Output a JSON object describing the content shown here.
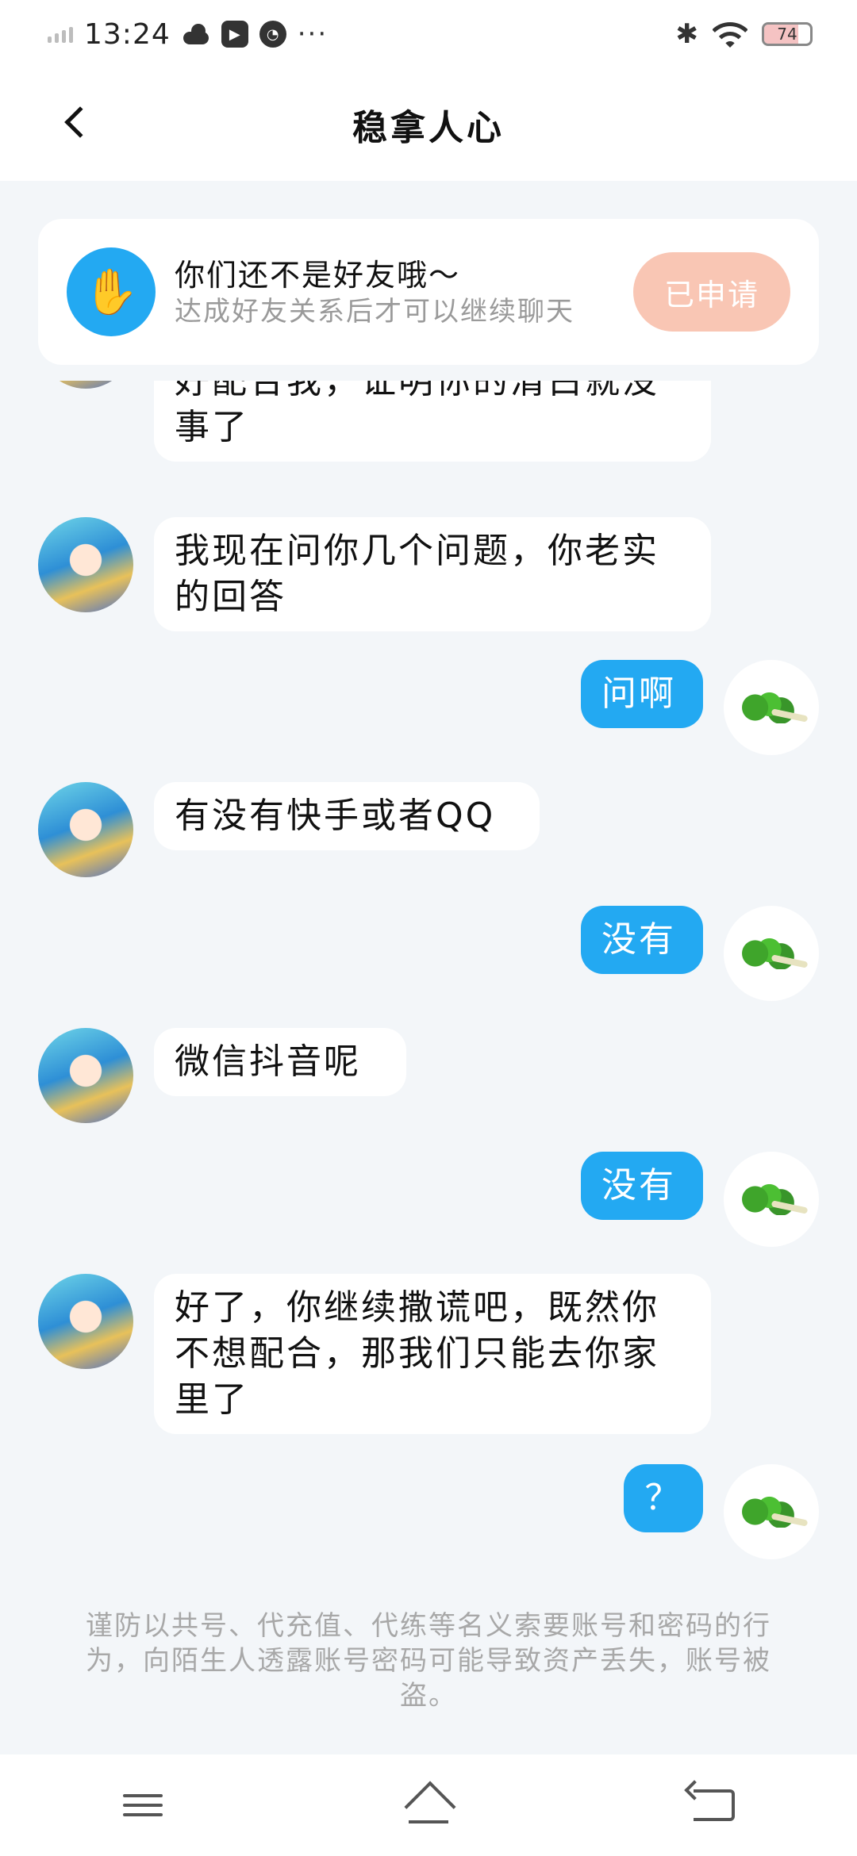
{
  "status_bar": {
    "time": "13:24",
    "dots": "···",
    "bluetooth": "✱",
    "battery": "74",
    "battery_level": 0.74
  },
  "header": {
    "title": "稳拿人心"
  },
  "notice": {
    "title": "你们还不是好友哦～",
    "subtitle": "达成好友关系后才可以继续聊天",
    "apply_label": "已申请"
  },
  "messages": [
    {
      "side": "other",
      "text": "好配合我，证明你的清白就没事了"
    },
    {
      "side": "other",
      "text": "我现在问你几个问题，你老实的回答"
    },
    {
      "side": "self",
      "text": "问啊"
    },
    {
      "side": "other",
      "text": "有没有快手或者QQ"
    },
    {
      "side": "self",
      "text": "没有"
    },
    {
      "side": "other",
      "text": "微信抖音呢"
    },
    {
      "side": "self",
      "text": "没有"
    },
    {
      "side": "other",
      "text": "好了，你继续撒谎吧，既然你不想配合，那我们只能去你家里了"
    },
    {
      "side": "self",
      "text": "？"
    }
  ],
  "footer": {
    "warning": "谨防以共号、代充值、代练等名义索要账号和密码的行为，向陌生人透露账号密码可能导致资产丢失，账号被盗。"
  },
  "colors": {
    "accent": "#23a9f2",
    "apply_button": "#f9c6b4",
    "background": "#f3f6f9"
  },
  "icons": {
    "back": "chevron-left-icon",
    "notice": "hand-icon",
    "nav_menu": "menu-icon",
    "nav_home": "home-icon",
    "nav_back": "back-icon"
  }
}
